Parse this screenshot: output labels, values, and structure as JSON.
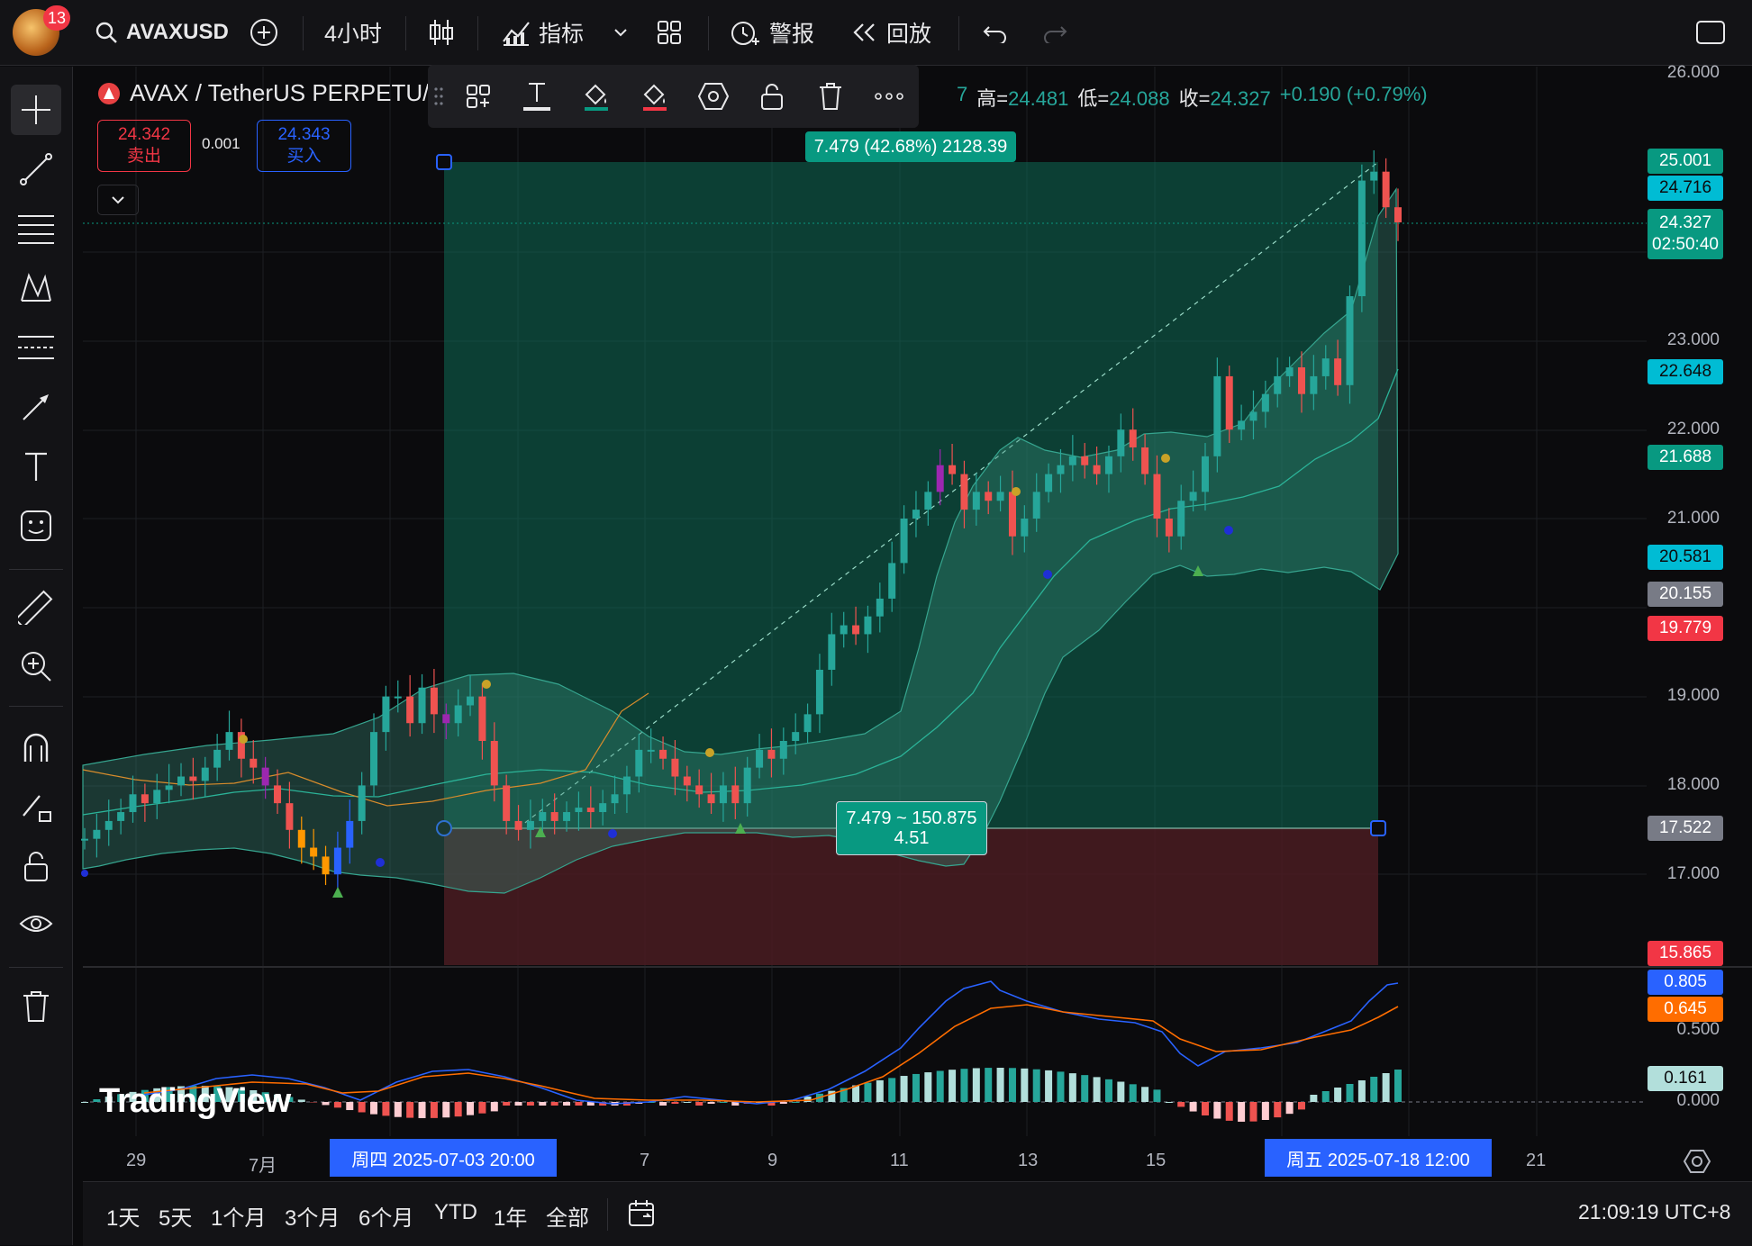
{
  "topbar": {
    "notification_count": "13",
    "symbol": "AVAXUSD",
    "interval": "4小时",
    "indicators_label": "指标",
    "alert_label": "警报",
    "replay_label": "回放"
  },
  "legend": {
    "title": "AVAX / TetherUS PERPETU/",
    "ohlc_tail": "7",
    "high_label": "高=",
    "high": "24.481",
    "low_label": "低=",
    "low": "24.088",
    "close_label": "收=",
    "close": "24.327",
    "change": "+0.190 (+0.79%)"
  },
  "trade": {
    "sell_price": "24.342",
    "sell_label": "卖出",
    "spread": "0.001",
    "buy_price": "24.343",
    "buy_label": "买入"
  },
  "position_tool": {
    "target_info": "7.479 (42.68%) 2128.39",
    "range_line1": "7.479 ~ 150.875",
    "range_line2": "4.51"
  },
  "price_axis": {
    "ticks": [
      "26.000",
      "23.000",
      "22.000",
      "21.000",
      "19.000",
      "18.000",
      "17.000"
    ],
    "labels": [
      {
        "value": "25.001",
        "color": "#089981"
      },
      {
        "value": "24.716",
        "color": "#00bcd4"
      },
      {
        "value": "22.648",
        "color": "#00bcd4"
      },
      {
        "value": "21.688",
        "color": "#089981"
      },
      {
        "value": "20.581",
        "color": "#00bcd4"
      },
      {
        "value": "20.155",
        "color": "#787b86"
      },
      {
        "value": "19.779",
        "color": "#f23645"
      },
      {
        "value": "17.522",
        "color": "#787b86"
      },
      {
        "value": "15.865",
        "color": "#f23645"
      }
    ],
    "current_price": "24.327",
    "countdown": "02:50:40"
  },
  "macd_axis": {
    "ticks": [
      "0.500",
      "0.000"
    ],
    "labels": [
      {
        "value": "0.805",
        "color": "#2962ff"
      },
      {
        "value": "0.645",
        "color": "#ff6d00"
      },
      {
        "value": "0.161",
        "color": "#b2dfdb"
      }
    ]
  },
  "time_axis": {
    "ticks": [
      "29",
      "7月",
      "7",
      "9",
      "11",
      "13",
      "15",
      "21"
    ],
    "highlight_start": "周四 2025-07-03   20:00",
    "highlight_end": "周五 2025-07-18   12:00"
  },
  "bottombar": {
    "ranges": [
      "1天",
      "5天",
      "1个月",
      "3个月",
      "6个月",
      "YTD",
      "1年",
      "全部"
    ],
    "clock": "21:09:19 UTC+8"
  },
  "logo": "TradingView",
  "colors": {
    "up": "#26a69a",
    "down": "#ef5350",
    "profit_zone": "#0f6b55",
    "loss_zone": "#4a1c22",
    "accent": "#2962ff"
  }
}
